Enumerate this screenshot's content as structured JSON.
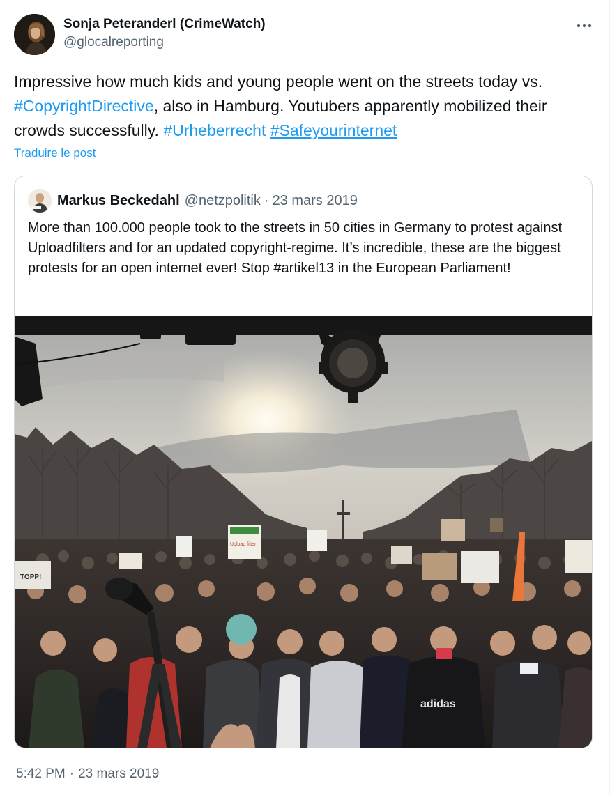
{
  "author": {
    "display_name": "Sonja Peteranderl (CrimeWatch)",
    "handle": "@glocalreporting"
  },
  "tweet": {
    "text_1": "Impressive how much kids and young people went on the streets today vs. ",
    "hashtag_1": "#CopyrightDirective",
    "text_2": ", also in Hamburg. Youtubers apparently mobilized their crowds successfully. ",
    "hashtag_2": "#Urheberrecht",
    "hashtag_3": "#Safeyourinternet",
    "translate_label": "Traduire le post"
  },
  "quoted": {
    "display_name": "Markus Beckedahl",
    "handle": "@netzpolitik",
    "separator": "·",
    "date": "23 mars 2019",
    "text": "More than 100.000 people took to the streets in 50 cities in Germany to protest against Uploadfilters and for an updated copyright-regime. It’s incredible, these are the biggest protests for an open internet ever! Stop #artikel13 in the European Parliament!",
    "sign_text_1": "TOPP!",
    "sign_text_2": "Upload filter",
    "shirt_text": "adidas"
  },
  "meta": {
    "time": "5:42 PM",
    "separator": "·",
    "date": "23 mars 2019"
  },
  "icons": {
    "more": "more-horizontal-icon"
  },
  "colors": {
    "link": "#1d9bf0",
    "text": "#0f1419",
    "secondary": "#536471",
    "border": "#cfd9de"
  }
}
